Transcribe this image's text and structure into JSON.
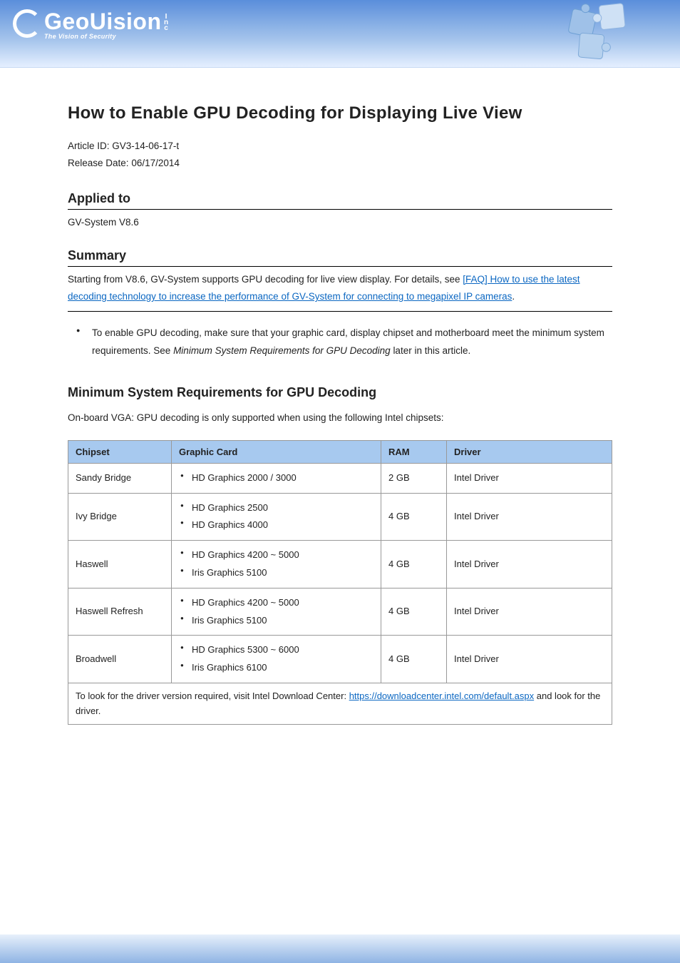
{
  "header": {
    "logo_text": "GeoUision",
    "logo_inc": "Inc",
    "logo_sub": "The Vision of Security"
  },
  "doc": {
    "title": "How to Enable GPU Decoding for Displaying Live View",
    "meta_id_label": "Article ID:",
    "meta_id": "GV3-14-06-17-t",
    "meta_date_label": "Release Date:",
    "meta_date": "06/17/2014",
    "applied_label": "Applied to",
    "applied_text": "GV-System V8.6",
    "summary_label": "Summary",
    "summary_para_pre": "Starting from V8.6, GV-System supports GPU decoding for live view display. For details, see ",
    "summary_link_text": "[FAQ] How to use the latest decoding technology to increase the performance of GV-System for connecting to megapixel IP cameras",
    "summary_link_href": "#",
    "summary_period": ".",
    "bullet_gpu": "To enable GPU decoding, make sure that your graphic card, display chipset and motherboard meet the minimum system requirements. See ",
    "bullet_gpu_em": "Minimum System Requirements for GPU Decoding",
    "bullet_gpu_after": " later in this article."
  },
  "reqs": {
    "heading": "Minimum System Requirements for GPU Decoding",
    "intro": "On-board VGA: GPU decoding is only supported when using the following Intel chipsets:",
    "table": {
      "headers": [
        "Chipset",
        "Graphic Card",
        "RAM",
        "Driver"
      ],
      "rows": [
        {
          "chipset": "Sandy Bridge",
          "gpus": [
            "HD Graphics 2000 / 3000"
          ],
          "ram": "2 GB",
          "driver": "Intel Driver"
        },
        {
          "chipset": "Ivy Bridge",
          "gpus": [
            "HD Graphics 2500",
            "HD Graphics 4000"
          ],
          "ram": "4 GB",
          "driver": "Intel Driver"
        },
        {
          "chipset": "Haswell",
          "gpus": [
            "HD Graphics 4200 ~ 5000",
            "Iris Graphics 5100"
          ],
          "ram": "4 GB",
          "driver": "Intel Driver"
        },
        {
          "chipset": "Haswell Refresh",
          "gpus": [
            "HD Graphics 4200 ~ 5000",
            "Iris Graphics 5100"
          ],
          "ram": "4 GB",
          "driver": "Intel Driver"
        },
        {
          "chipset": "Broadwell",
          "gpus": [
            "HD Graphics 5300 ~ 6000",
            "Iris Graphics 6100"
          ],
          "ram": "4 GB",
          "driver": "Intel Driver"
        }
      ],
      "driver_note_pre": "To look for the driver version required, visit Intel Download Center: ",
      "driver_link_text": "https://downloadcenter.intel.com/default.aspx",
      "driver_note_post": " and look for the driver."
    }
  }
}
